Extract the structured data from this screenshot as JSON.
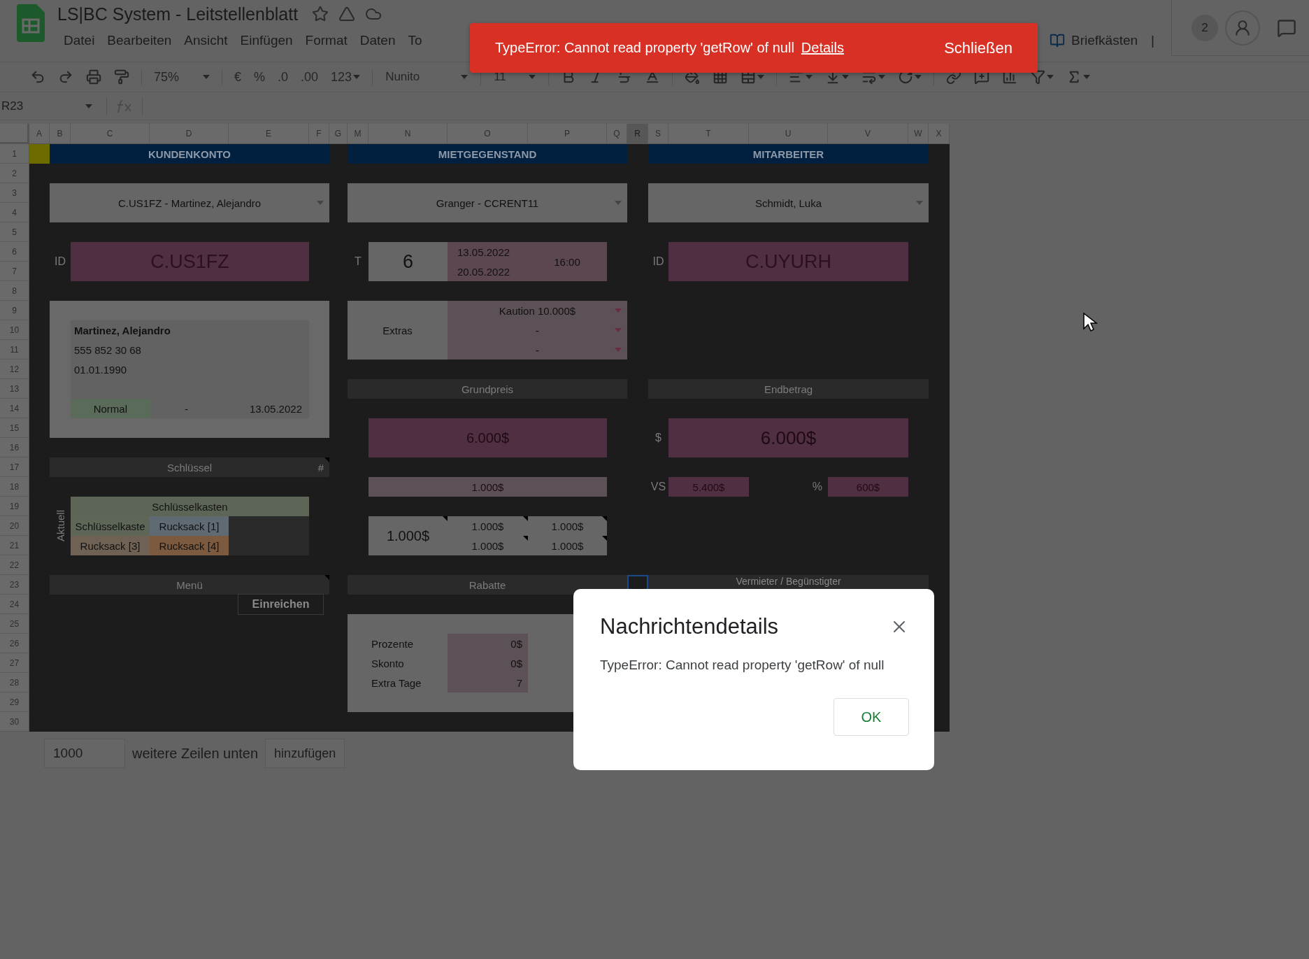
{
  "app": {
    "title": "LS|BC System - Leitstellenblatt",
    "menu": [
      "Datei",
      "Bearbeiten",
      "Ansicht",
      "Einfügen",
      "Format",
      "Daten",
      "To"
    ],
    "extra_menu": "Briefkästen",
    "menu_separator": "|",
    "collaborators": "2"
  },
  "toolbar": {
    "zoom": "75%",
    "currency": "€",
    "percent": "%",
    "decrease_decimals": ".0",
    "increase_decimals": ".00",
    "number_format": "123",
    "font": "Nunito",
    "font_size": "11"
  },
  "formula_bar": {
    "name_box": "R23"
  },
  "toast": {
    "message": "TypeError: Cannot read property 'getRow' of null",
    "link": "Details",
    "action": "Schließen"
  },
  "sheet": {
    "columns": [
      {
        "label": "A",
        "selected": false
      },
      {
        "label": "B",
        "selected": false
      },
      {
        "label": "C",
        "selected": false
      },
      {
        "label": "D",
        "selected": false
      },
      {
        "label": "E",
        "selected": false
      },
      {
        "label": "F",
        "selected": false
      },
      {
        "label": "G",
        "selected": false
      },
      {
        "label": "M",
        "selected": false
      },
      {
        "label": "N",
        "selected": false
      },
      {
        "label": "O",
        "selected": false
      },
      {
        "label": "P",
        "selected": false
      },
      {
        "label": "Q",
        "selected": false
      },
      {
        "label": "R",
        "selected": true
      },
      {
        "label": "S",
        "selected": false
      },
      {
        "label": "T",
        "selected": false
      },
      {
        "label": "U",
        "selected": false
      },
      {
        "label": "V",
        "selected": false
      },
      {
        "label": "W",
        "selected": false
      },
      {
        "label": "X",
        "selected": false
      }
    ],
    "rows": [
      "1",
      "2",
      "3",
      "4",
      "5",
      "6",
      "7",
      "8",
      "9",
      "10",
      "11",
      "12",
      "13",
      "14",
      "15",
      "16",
      "17",
      "18",
      "19",
      "20",
      "21",
      "22",
      "23",
      "24",
      "25",
      "26",
      "27",
      "28",
      "29",
      "30"
    ],
    "customer": {
      "header": "KUNDENKONTO",
      "select": "C.US1FZ - Martinez, Alejandro",
      "id_label": "ID",
      "id": "C.US1FZ",
      "name": "Martinez, Alejandro",
      "phone": "555 852 30 68",
      "birthdate": "01.01.1990",
      "status": "Normal",
      "status_extra": "-",
      "date": "13.05.2022"
    },
    "keys": {
      "header": "Schlüssel",
      "hash": "#",
      "side_label": "Aktuell",
      "title": "Schlüsselkasten",
      "items": [
        {
          "label": "Schlüsselkaste",
          "color": "#5e6657"
        },
        {
          "label": "Rucksack [1]",
          "color": "#5f6a73"
        },
        {
          "label": "Rucksack [3]",
          "color": "#6f6154"
        },
        {
          "label": "Rucksack [4]",
          "color": "#7b5a3f"
        }
      ]
    },
    "menu_section": {
      "header": "Menü",
      "button": "Einreichen"
    },
    "rental": {
      "header": "MIETGEGENSTAND",
      "select": "Granger - CCRENT11",
      "days_label": "T",
      "days": "6",
      "start": "13.05.2022",
      "end": "20.05.2022",
      "time": "16:00",
      "extras_label": "Extras",
      "extras": [
        "Kaution 10.000$",
        "-",
        "-"
      ],
      "base_header": "Grundpreis",
      "base_price": "6.000$",
      "daily": "1.000$",
      "breakdown_main": "1.000$",
      "breakdown": [
        "1.000$",
        "1.000$",
        "1.000$",
        "1.000$"
      ],
      "discount_header": "Rabatte",
      "discounts": [
        {
          "label": "Prozente",
          "value": "0$"
        },
        {
          "label": "Skonto",
          "value": "0$"
        },
        {
          "label": "Extra Tage",
          "value": "7"
        }
      ]
    },
    "employee": {
      "header": "MITARBEITER",
      "select": "Schmidt, Luka",
      "id_label": "ID",
      "id": "C.UYURH",
      "total_header": "Endbetrag",
      "currency": "$",
      "total": "6.000$",
      "vs_label": "VS",
      "vs": "5.400$",
      "percent_label": "%",
      "percent": "600$",
      "landlord_header": "Vermieter / Begünstigter"
    }
  },
  "footer": {
    "rows_value": "1000",
    "label": "weitere Zeilen unten",
    "button": "hinzufügen"
  },
  "dialog": {
    "title": "Nachrichtendetails",
    "message": "TypeError: Cannot read property 'getRow' of null",
    "button": "OK"
  }
}
